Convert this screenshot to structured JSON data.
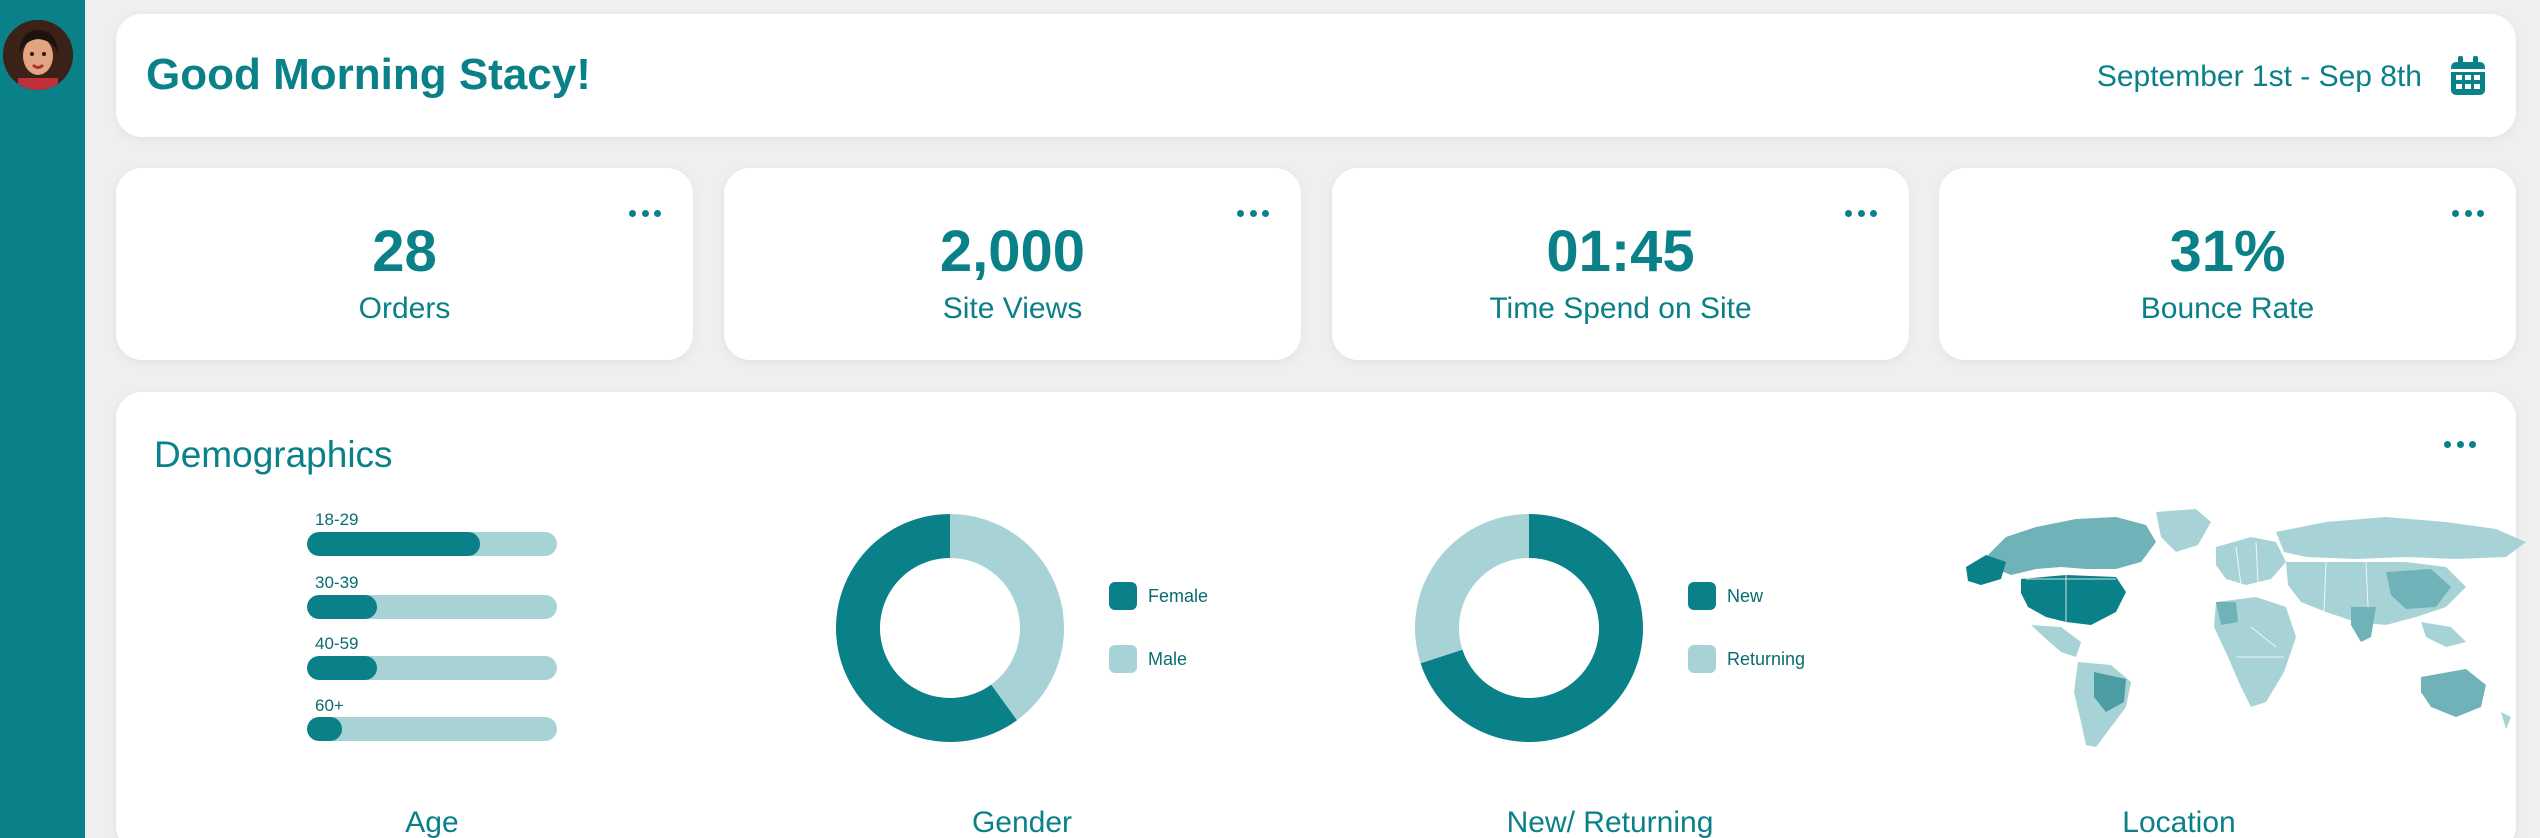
{
  "header": {
    "greeting": "Good Morning Stacy!",
    "date_range": "September 1st - Sep 8th"
  },
  "stats": [
    {
      "value": "28",
      "label": "Orders"
    },
    {
      "value": "2,000",
      "label": "Site Views"
    },
    {
      "value": "01:45",
      "label": "Time Spend on Site"
    },
    {
      "value": "31%",
      "label": "Bounce Rate"
    }
  ],
  "demographics": {
    "title": "Demographics",
    "age": {
      "label": "Age",
      "groups": [
        {
          "name": "18-29",
          "fraction": 0.69
        },
        {
          "name": "30-39",
          "fraction": 0.28
        },
        {
          "name": "40-59",
          "fraction": 0.28
        },
        {
          "name": "60+",
          "fraction": 0.14
        }
      ]
    },
    "gender": {
      "label": "Gender",
      "slices": [
        {
          "name": "Female",
          "fraction": 0.6,
          "color": "#0a8088"
        },
        {
          "name": "Male",
          "fraction": 0.4,
          "color": "#a8d3d6"
        }
      ]
    },
    "new_returning": {
      "label": "New/ Returning",
      "slices": [
        {
          "name": "New",
          "fraction": 0.7,
          "color": "#0a8088"
        },
        {
          "name": "Returning",
          "fraction": 0.3,
          "color": "#a8d3d6"
        }
      ]
    },
    "location": {
      "label": "Location"
    }
  },
  "colors": {
    "primary": "#0a8088",
    "light": "#a8d3d6",
    "background": "#efefef"
  },
  "icons": {
    "calendar": "calendar-icon",
    "more": "more-dots-icon"
  }
}
